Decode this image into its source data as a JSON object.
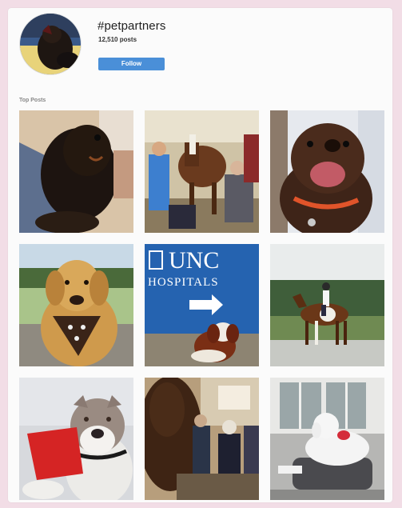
{
  "header": {
    "hashtag": "#petpartners",
    "post_count": "12,510 posts",
    "follow_label": "Follow"
  },
  "top_posts": {
    "title": "Top Posts"
  },
  "tile_sign": {
    "line1": "UNC",
    "line2": "HOSPITALS"
  },
  "colors": {
    "background": "#f2dde6",
    "follow_button": "#4a8fd8",
    "sign_blue": "#2563b0"
  }
}
